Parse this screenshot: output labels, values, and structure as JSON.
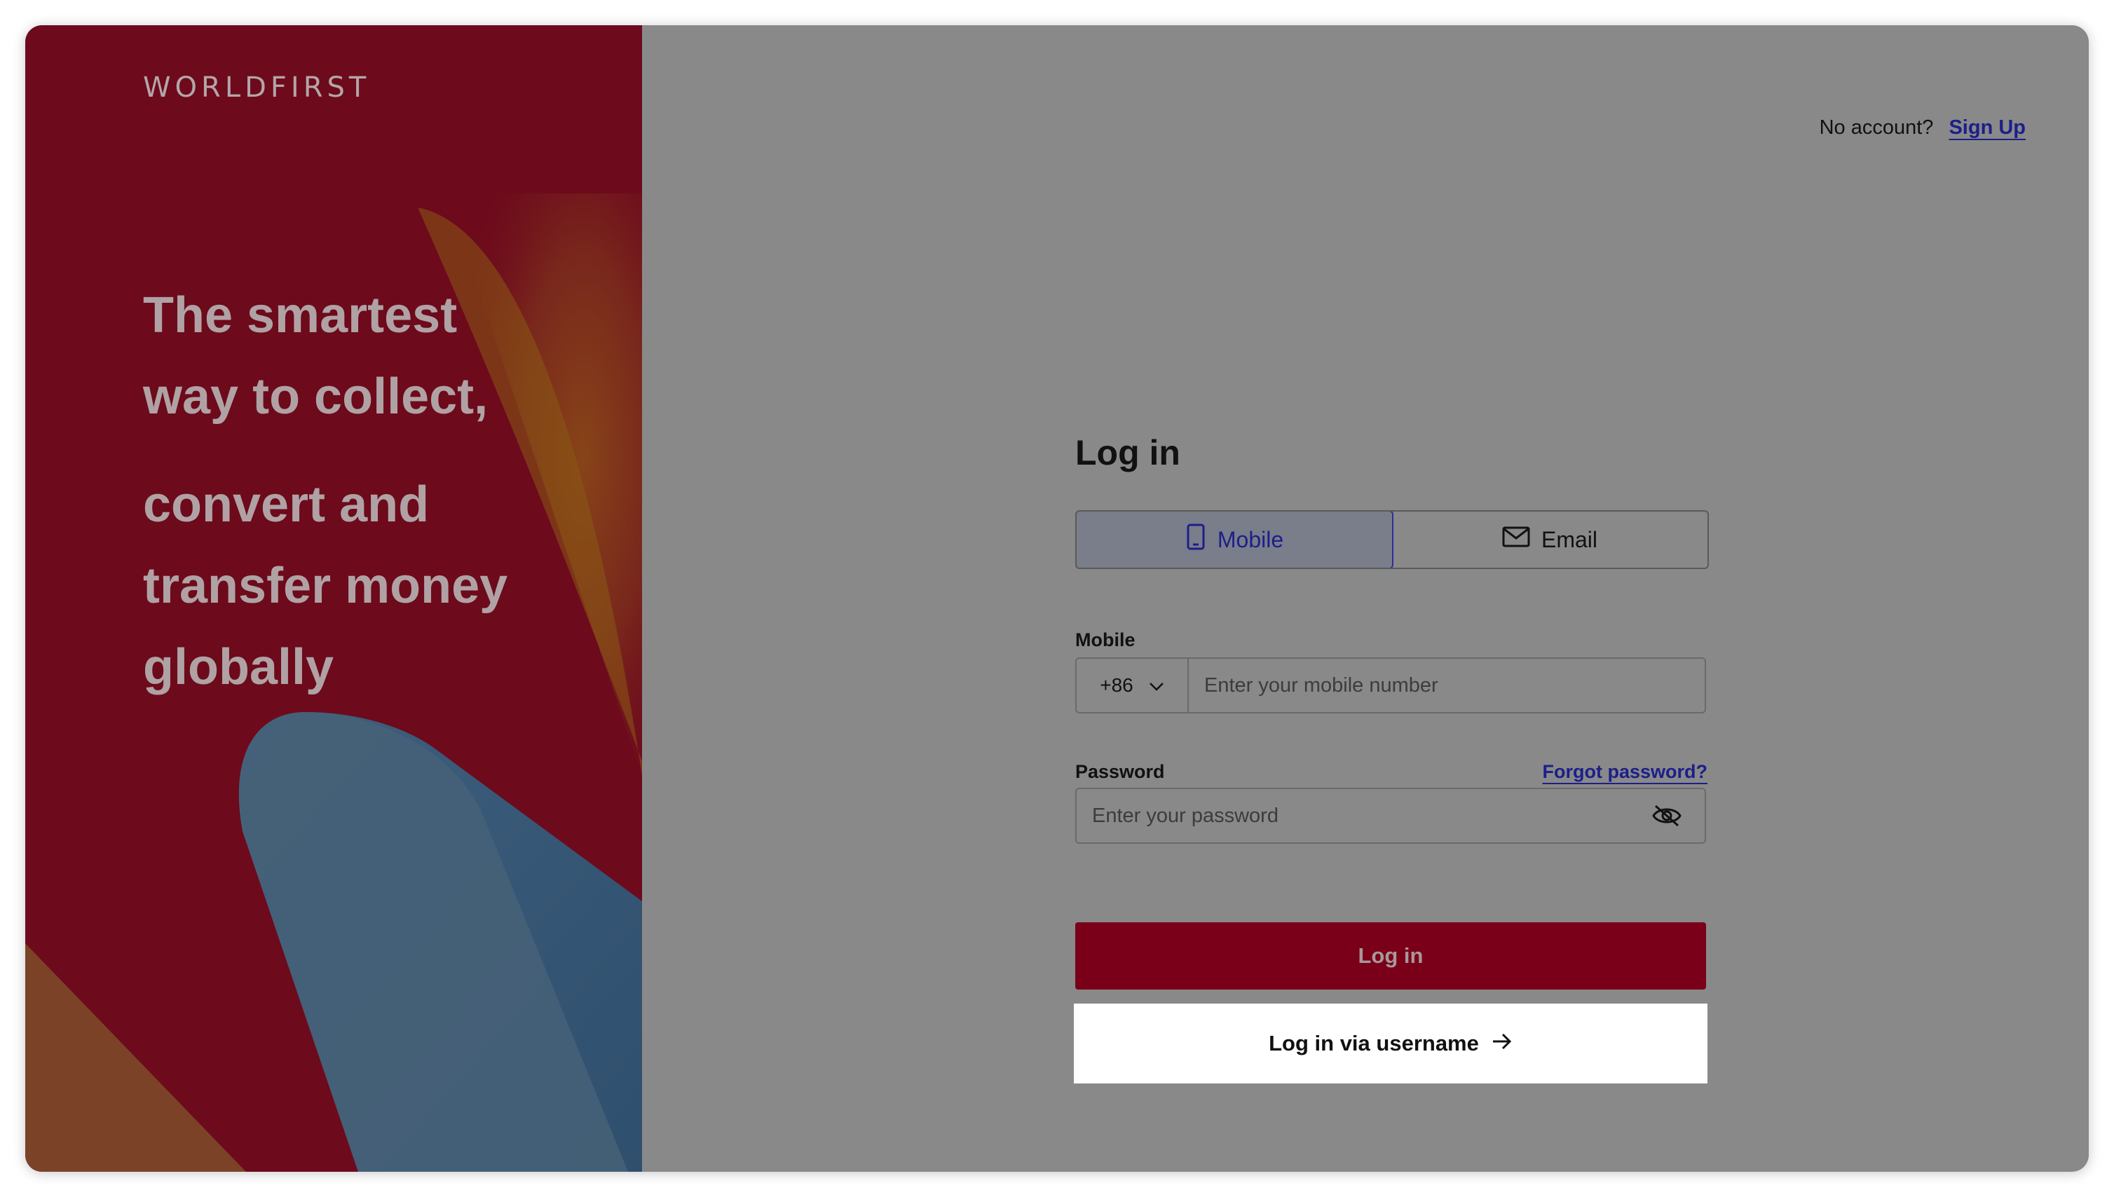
{
  "brand": {
    "name": "WORLDFIRST"
  },
  "promo": {
    "tagline_line1": "The smartest",
    "tagline_line2": "way to collect,",
    "tagline_line3": "convert and",
    "tagline_line4": "transfer money",
    "tagline_line5": "globally"
  },
  "header": {
    "no_account_text": "No account?",
    "signup_label": "Sign Up"
  },
  "form": {
    "title": "Log in",
    "tabs": [
      {
        "label": "Mobile",
        "icon": "phone-icon",
        "active": true
      },
      {
        "label": "Email",
        "icon": "mail-icon",
        "active": false
      }
    ],
    "mobile": {
      "label": "Mobile",
      "country_code": "+86",
      "placeholder": "Enter your mobile number"
    },
    "password": {
      "label": "Password",
      "forgot_label": "Forgot password?",
      "placeholder": "Enter your password"
    },
    "login_button": "Log in",
    "username_button": "Log in via username"
  },
  "colors": {
    "brand_red": "#7a0019",
    "link_blue": "#1c1f8a",
    "overlay_gray": "#898989"
  }
}
